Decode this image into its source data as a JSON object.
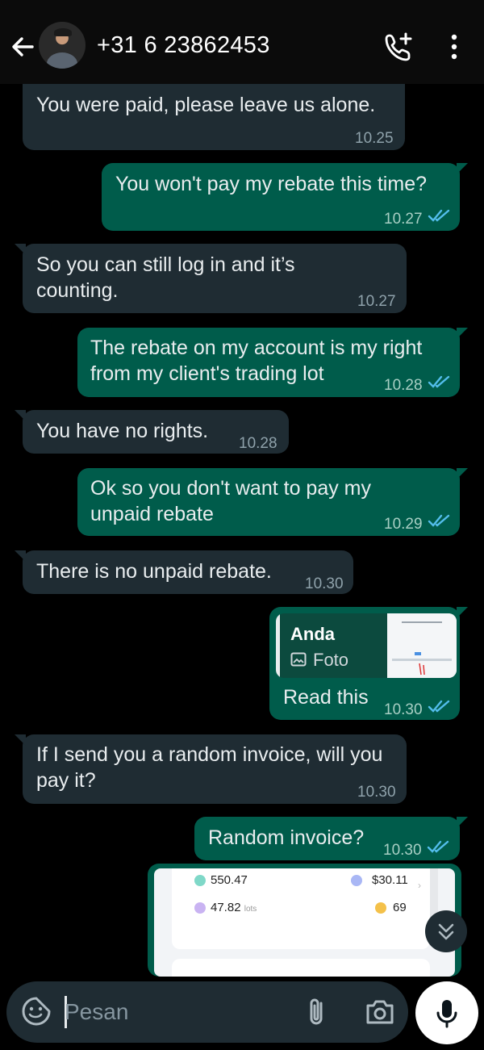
{
  "header": {
    "title": "+31 6 23862453",
    "back_icon": "arrow-left-icon",
    "call_icon": "add-call-icon",
    "menu_icon": "vertical-dots-icon"
  },
  "messages": [
    {
      "dir": "in",
      "text": "You were paid, please leave us alone.",
      "time": "10.25"
    },
    {
      "dir": "out",
      "text": "You won't pay my rebate this time?",
      "time": "10.27",
      "status": "read"
    },
    {
      "dir": "in",
      "text": "So you can still log in and it’s counting.",
      "time": "10.27"
    },
    {
      "dir": "out",
      "text": "The rebate on my account is my right from my client's trading lot",
      "time": "10.28",
      "status": "read"
    },
    {
      "dir": "in",
      "text": "You have no rights.",
      "time": "10.28"
    },
    {
      "dir": "out",
      "text": "Ok so you don't want to pay my unpaid rebate",
      "time": "10.29",
      "status": "read"
    },
    {
      "dir": "in",
      "text": "There is no unpaid rebate.",
      "time": "10.30"
    },
    {
      "dir": "out",
      "text": "Read this",
      "time": "10.30",
      "status": "read",
      "reply": {
        "name": "Anda",
        "label": "Foto"
      }
    },
    {
      "dir": "in",
      "text": "If I send you a random invoice, will you pay it?",
      "time": "10.30"
    },
    {
      "dir": "out",
      "text": "Random invoice?",
      "time": "10.30",
      "status": "read"
    }
  ],
  "image_preview": {
    "balance": "550.47",
    "lots": "47.82",
    "lots_unit": "lots",
    "amount": "$30.11",
    "count": "69"
  },
  "composer": {
    "placeholder": "Pesan"
  },
  "colors": {
    "incoming": "#1f2c33",
    "outgoing": "#005c4b",
    "read_ticks": "#53bdeb"
  }
}
